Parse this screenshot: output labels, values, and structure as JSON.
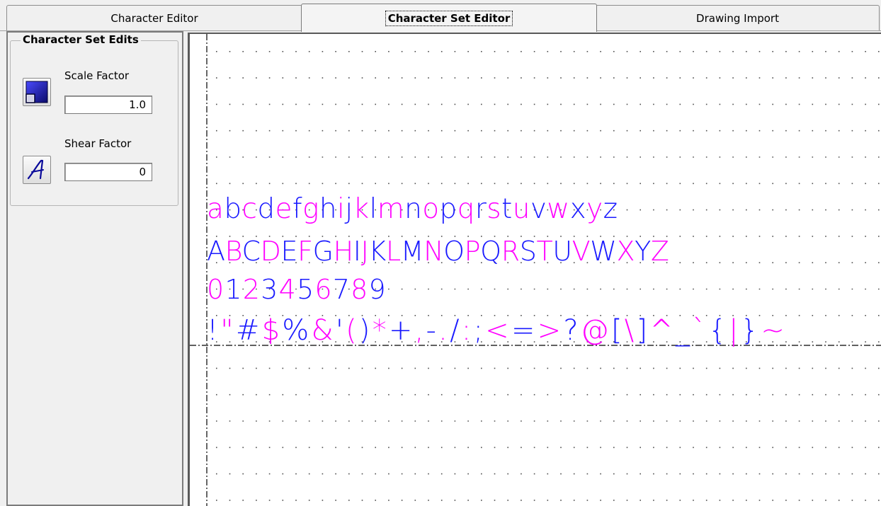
{
  "tabs": [
    {
      "label": "Character Editor",
      "active": false
    },
    {
      "label": "Character Set Editor",
      "active": true
    },
    {
      "label": "Drawing Import",
      "active": false
    }
  ],
  "edits": {
    "group_title": "Character Set Edits",
    "scale_label": "Scale Factor",
    "scale_value": "1.0",
    "shear_label": "Shear Factor",
    "shear_value": "0",
    "scale_icon": "scale-icon",
    "shear_icon": "shear-italic-icon"
  },
  "canvas": {
    "lines": [
      "abcdefghijklmnopqrstuvwxyz",
      "ABCDEFGHIJKLMNOPQRSTUVWXYZ",
      "0123456789",
      "!\"#$%&'()*+,-./:;<=>?@[\\]^_`{|}~"
    ],
    "colors": {
      "primary": "#ff00ff",
      "secondary": "#1a1aff",
      "grid": "#505050",
      "axis": "#000000"
    }
  }
}
